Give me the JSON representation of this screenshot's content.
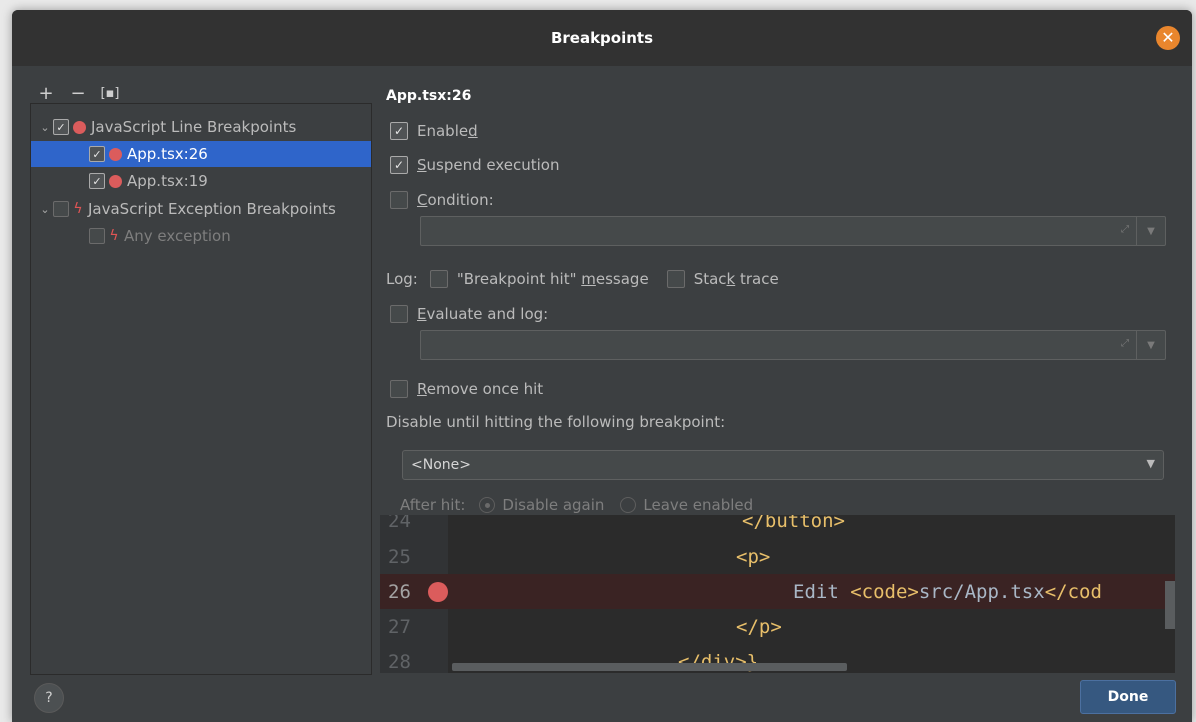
{
  "window": {
    "title": "Breakpoints"
  },
  "toolbar": {
    "add": "+",
    "remove": "−",
    "group": "[▪]"
  },
  "tree": {
    "group1": {
      "label": "JavaScript Line Breakpoints",
      "checked": true
    },
    "item1": {
      "label": "App.tsx:26",
      "checked": true,
      "selected": true
    },
    "item2": {
      "label": "App.tsx:19",
      "checked": true
    },
    "group2": {
      "label": "JavaScript Exception Breakpoints",
      "checked": false
    },
    "item3": {
      "label": "Any exception",
      "checked": false
    }
  },
  "details": {
    "heading": "App.tsx:26",
    "enabled": {
      "pre": "Enable",
      "key": "d",
      "post": ""
    },
    "suspend": {
      "pre": "",
      "key": "S",
      "post": "uspend execution"
    },
    "condition": {
      "pre": "",
      "key": "C",
      "post": "ondition:"
    },
    "log_label": "Log:",
    "log_message": {
      "pre": "\"Breakpoint hit\" ",
      "key": "m",
      "post": "essage"
    },
    "stack_trace": {
      "pre": "Stac",
      "key": "k",
      "post": " trace"
    },
    "evaluate": {
      "pre": "",
      "key": "E",
      "post": "valuate and log:"
    },
    "remove_once": {
      "pre": "",
      "key": "R",
      "post": "emove once hit"
    },
    "disable_until": "Disable until hitting the following breakpoint:",
    "dropdown_value": "<None>",
    "after_hit_label": "After hit:",
    "radio_disable": "Disable again",
    "radio_leave": "Leave enabled"
  },
  "editor": {
    "lines": [
      {
        "num": "24",
        "code": "</button>"
      },
      {
        "num": "25",
        "code": "<p>"
      },
      {
        "num": "26",
        "pre": "Edit ",
        "tag": "<code>",
        "text": "src/App.tsx",
        "tag2": "</cod"
      },
      {
        "num": "27",
        "code": "</p>"
      },
      {
        "num": "28",
        "code": "</div>}"
      }
    ]
  },
  "footer": {
    "help": "?",
    "done": "Done"
  },
  "colors": {
    "accent_blue": "#2f65ca",
    "breakpoint_red": "#db5c5c",
    "tag_yellow": "#e8bf6a",
    "dialog_bg": "#3c3f41"
  }
}
